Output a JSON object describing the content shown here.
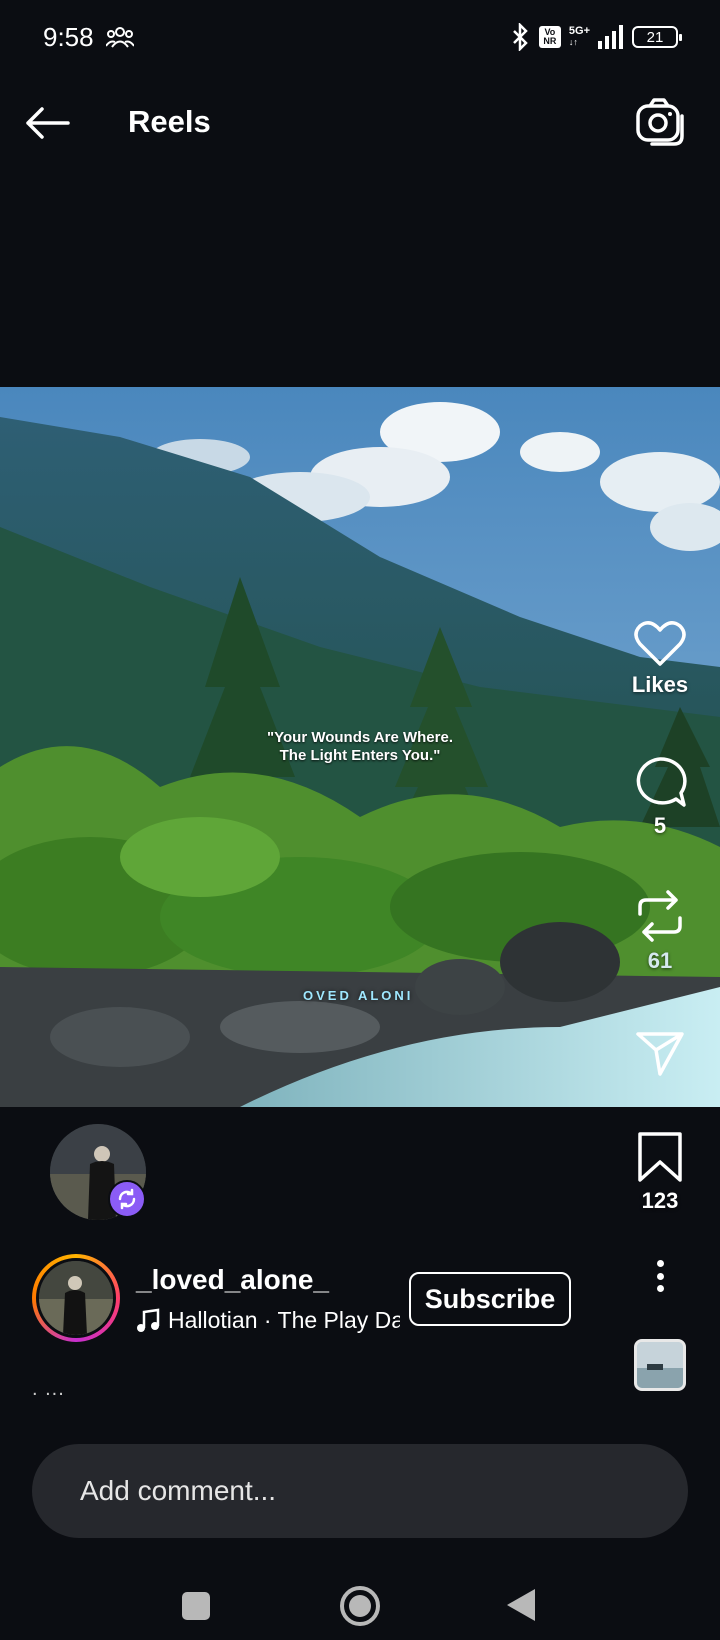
{
  "status_bar": {
    "time": "9:58",
    "network_badge_top": "Vo",
    "network_badge_bottom": "NR",
    "network_type": "5G+",
    "battery": "21"
  },
  "header": {
    "title": "Reels"
  },
  "video": {
    "quote_line1": "\"Your Wounds Are Where.",
    "quote_line2": "The Light Enters You.\"",
    "watermark": "OVED ALONI"
  },
  "actions": {
    "like_label": "Likes",
    "comment_count": "5",
    "remix_count": "61",
    "save_count": "123"
  },
  "author": {
    "username": "_loved_alone_",
    "music_track": "Hallotian · The Play Date",
    "subscribe_label": "Subscribe"
  },
  "caption": {
    "ellipsis": ". ..."
  },
  "comment": {
    "placeholder": "Add comment..."
  },
  "colors": {
    "background": "#0b0d12",
    "comment_box": "#26282d",
    "remix_badge": "#8b5cf6"
  }
}
